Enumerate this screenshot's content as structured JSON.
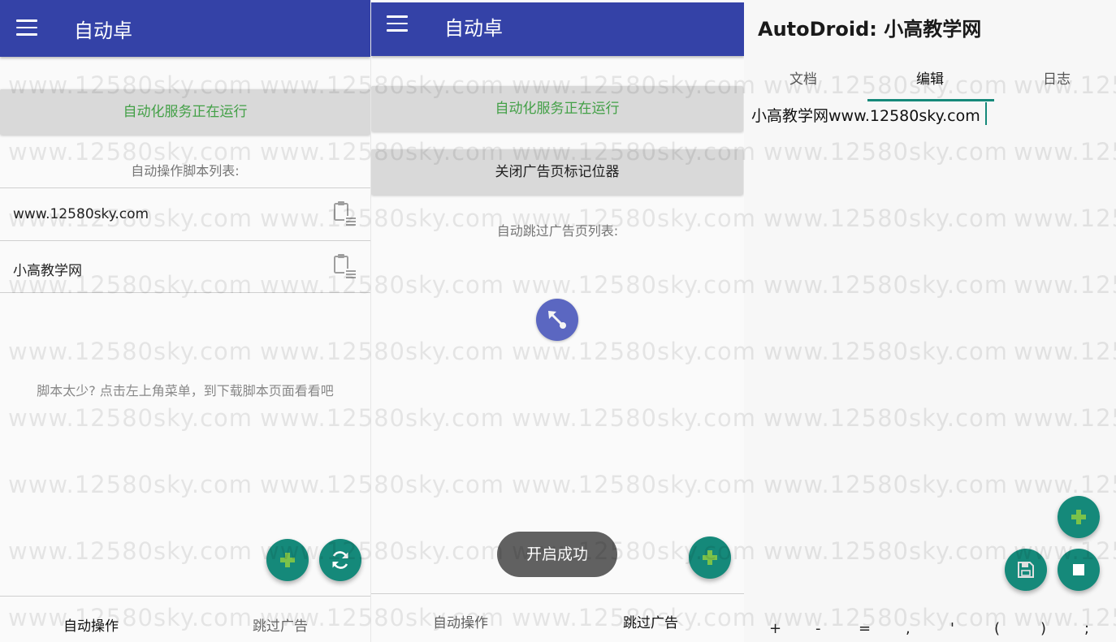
{
  "panel1": {
    "appbar": {
      "title": "自动卓"
    },
    "service_button": "自动化服务正在运行",
    "list_caption": "自动操作脚本列表:",
    "scripts": [
      {
        "name": "www.12580sky.com"
      },
      {
        "name": "小高教学网"
      }
    ],
    "empty_hint": "脚本太少? 点击左上角菜单，到下载脚本页面看看吧",
    "bottom_nav": [
      "自动操作",
      "跳过广告"
    ],
    "icons": {
      "menu": "menu-icon",
      "add": "plus-icon",
      "refresh": "refresh-icon",
      "script_action": "clipboard-list-icon"
    }
  },
  "panel2": {
    "appbar": {
      "title": "自动卓"
    },
    "service_button": "自动化服务正在运行",
    "close_marker_button": "关闭广告页标记位器",
    "list_caption": "自动跳过广告页列表:",
    "toast": "开启成功",
    "bottom_nav": [
      "自动操作",
      "跳过广告"
    ],
    "icons": {
      "menu": "menu-icon",
      "add": "plus-icon",
      "floating": "pointer-arrow-icon"
    }
  },
  "panel3": {
    "title": "AutoDroid: 小高教学网",
    "tabs": [
      "文档",
      "编辑",
      "日志"
    ],
    "active_tab": "编辑",
    "editor_text": "小高教学网www.12580sky.com",
    "symbols": [
      "+",
      "-",
      "=",
      ",",
      "'",
      "(",
      ")",
      ";"
    ],
    "icons": {
      "add": "plus-icon",
      "save": "floppy-disk-icon",
      "stop": "stop-icon"
    }
  },
  "watermark": "www.12580sky.com",
  "colors": {
    "appbar": "#3442a7",
    "accent_green": "#43a047",
    "fab": "#15897a",
    "fab_plus": "#7bc24a",
    "floating_button": "#5b67c1",
    "toast": "#616161"
  }
}
